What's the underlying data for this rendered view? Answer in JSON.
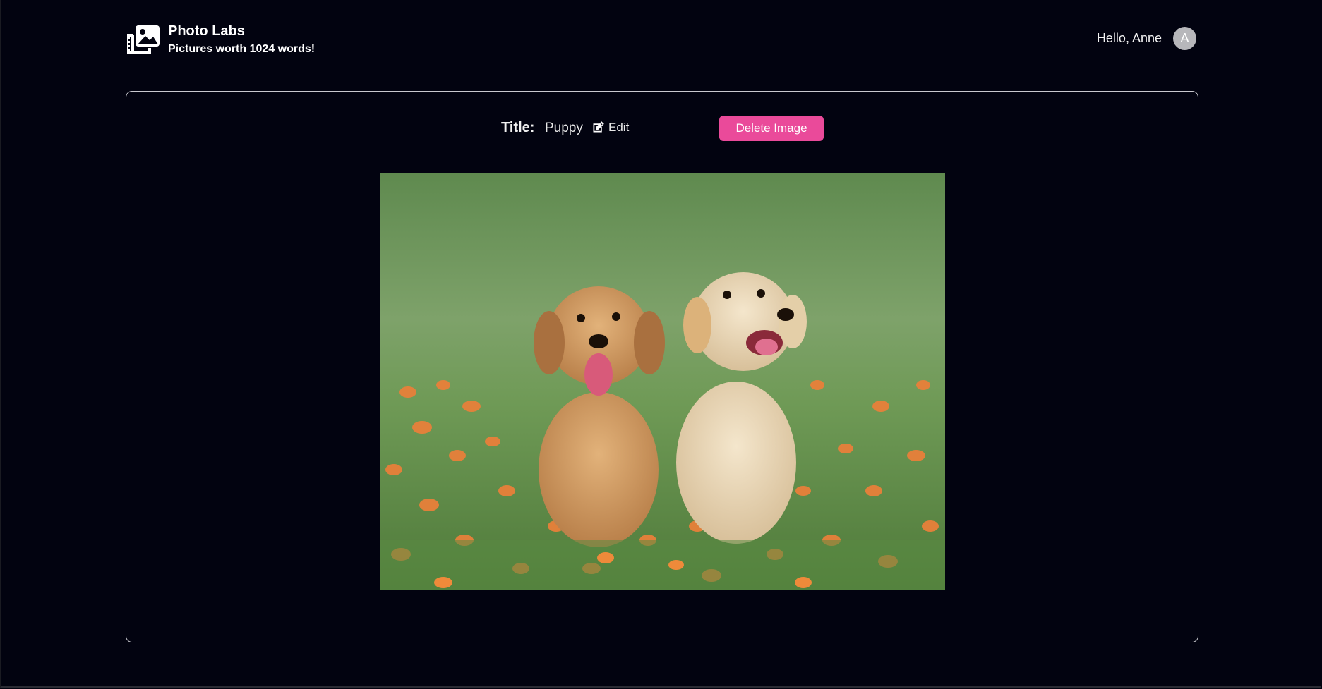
{
  "brand": {
    "name": "Photo Labs",
    "tagline": "Pictures worth 1024 words!",
    "logo_icon": "photo-gallery-icon"
  },
  "user": {
    "greeting": "Hello, Anne",
    "avatar_initial": "A"
  },
  "image_panel": {
    "title_label": "Title:",
    "title_value": "Puppy",
    "edit_label": "Edit",
    "edit_icon": "edit-icon",
    "delete_label": "Delete Image",
    "photo_alt": "Puppy"
  },
  "colors": {
    "background": "#020310",
    "accent": "#ea4a9a",
    "card_border": "#c9c9cf"
  }
}
